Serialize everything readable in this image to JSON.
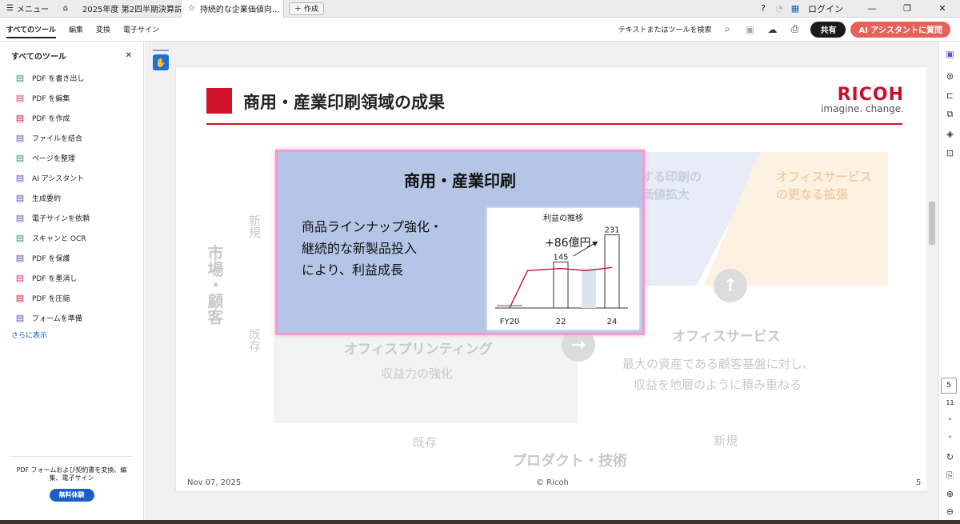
{
  "tabbar": {
    "menu_label": "メニュー",
    "tabs": [
      {
        "label": "2025年度 第2四半期決算説..."
      },
      {
        "label": "持続的な企業価値向..."
      }
    ],
    "new_tab_label": "作成",
    "login_label": "ログイン"
  },
  "toolbar": {
    "tabs": [
      "すべてのツール",
      "編集",
      "変換",
      "電子サイン"
    ],
    "search_label": "テキストまたはツールを検索",
    "share_label": "共有",
    "ai_label": "AI アシスタントに質問"
  },
  "leftpanel": {
    "title": "すべてのツール",
    "items": [
      {
        "label": "PDF を書き出し",
        "icon": "export-pdf-icon",
        "color": "#2e9e6b"
      },
      {
        "label": "PDF を編集",
        "icon": "edit-pdf-icon",
        "color": "#d63b8a"
      },
      {
        "label": "PDF を作成",
        "icon": "create-pdf-icon",
        "color": "#d2142b"
      },
      {
        "label": "ファイルを結合",
        "icon": "combine-files-icon",
        "color": "#7a4dc7"
      },
      {
        "label": "ページを整理",
        "icon": "organize-pages-icon",
        "color": "#2e9e6b"
      },
      {
        "label": "AI アシスタント",
        "icon": "ai-assistant-icon",
        "color": "#6b4dc7"
      },
      {
        "label": "生成要約",
        "icon": "summary-icon",
        "color": "#6b4dc7"
      },
      {
        "label": "電子サインを依頼",
        "icon": "request-signature-icon",
        "color": "#7a4dc7"
      },
      {
        "label": "スキャンと OCR",
        "icon": "scan-ocr-icon",
        "color": "#2e9e6b"
      },
      {
        "label": "PDF を保護",
        "icon": "protect-pdf-icon",
        "color": "#5a4dc7"
      },
      {
        "label": "PDF を墨消し",
        "icon": "redact-pdf-icon",
        "color": "#d63b8a"
      },
      {
        "label": "PDF を圧縮",
        "icon": "compress-pdf-icon",
        "color": "#d2142b"
      },
      {
        "label": "フォームを準備",
        "icon": "prepare-form-icon",
        "color": "#7a4dc7"
      }
    ],
    "more_label": "さらに表示",
    "footer_text": "PDF フォームおよび契約書を変換、編集、電子サイン",
    "trial_label": "無料体験"
  },
  "slide": {
    "title": "商用・産業印刷領域の成果",
    "logo_brand": "RICOH",
    "logo_tag": "imagine. change.",
    "bg_blue_text": "する印刷の\n価値拡大",
    "bg_orange_text": "オフィスサービス\nの更なる拡張",
    "axis_vertical": "市場・顧客",
    "axis_new": "新規",
    "axis_existing": "既存",
    "office_printing": "オフィスプリンティング",
    "office_printing_sub": "収益力の強化",
    "office_services": "オフィスサービス",
    "office_services_sub1": "最大の資産である顧客基盤に対し、",
    "office_services_sub2": "収益を地層のように積み重ねる",
    "bottom_existing": "既存",
    "bottom_new": "新規",
    "bottom_axis": "プロダクト・技術",
    "highlight_title": "商用・産業印刷",
    "highlight_lines": [
      "商品ラインナップ強化・",
      "継続的な新製品投入",
      "により、利益成長"
    ],
    "footer_date": "Nov 07, 2025",
    "footer_copyright": "© Ricoh",
    "footer_page": "5"
  },
  "chart_data": {
    "type": "bar",
    "title": "利益の推移",
    "categories": [
      "FY20",
      "22",
      "24"
    ],
    "values": [
      0,
      145,
      231
    ],
    "annotation": "+86億円",
    "ghost_bar_value": 125,
    "line_points": [
      [
        0,
        0
      ],
      [
        0.35,
        118
      ],
      [
        1,
        125
      ],
      [
        1.5,
        118
      ],
      [
        2,
        128
      ]
    ]
  },
  "rail": {
    "page_current": "5",
    "page_total": "11"
  }
}
